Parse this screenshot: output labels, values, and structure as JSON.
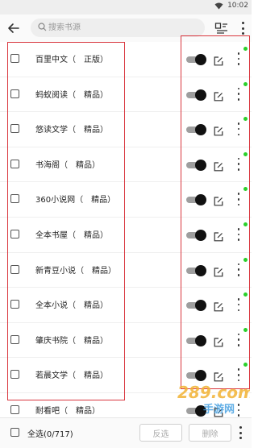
{
  "status_bar": {
    "time": "10:02"
  },
  "toolbar": {
    "back_icon": "arrow-left-icon",
    "search_placeholder": "搜索书源",
    "group_icon": "group-icon",
    "more_icon": "more-vertical-icon"
  },
  "sources": [
    {
      "name": "百里中文（　正版）",
      "enabled": true
    },
    {
      "name": "蚂蚁阅读（　精品）",
      "enabled": true
    },
    {
      "name": "悠读文学（　精品）",
      "enabled": true
    },
    {
      "name": "书海阁（　精品）",
      "enabled": true
    },
    {
      "name": "360小说网（　精品）",
      "enabled": true
    },
    {
      "name": "全本书屋（　精品）",
      "enabled": true
    },
    {
      "name": "新青豆小说（　精品）",
      "enabled": true
    },
    {
      "name": "全本小说（　精品）",
      "enabled": true
    },
    {
      "name": "肇庆书院（　精品）",
      "enabled": true
    },
    {
      "name": "若晨文学（　精品）",
      "enabled": true
    },
    {
      "name": "耐看吧（　精品）",
      "enabled": true
    }
  ],
  "bottom_bar": {
    "select_all": "全选(0/717)",
    "reverse": "反选",
    "delete": "删除"
  },
  "watermark": {
    "text": "289.com",
    "sub": "手游网"
  },
  "colors": {
    "highlight": "#d9363e",
    "status_dot": "#2bd02b",
    "switch_on": "#111111"
  }
}
